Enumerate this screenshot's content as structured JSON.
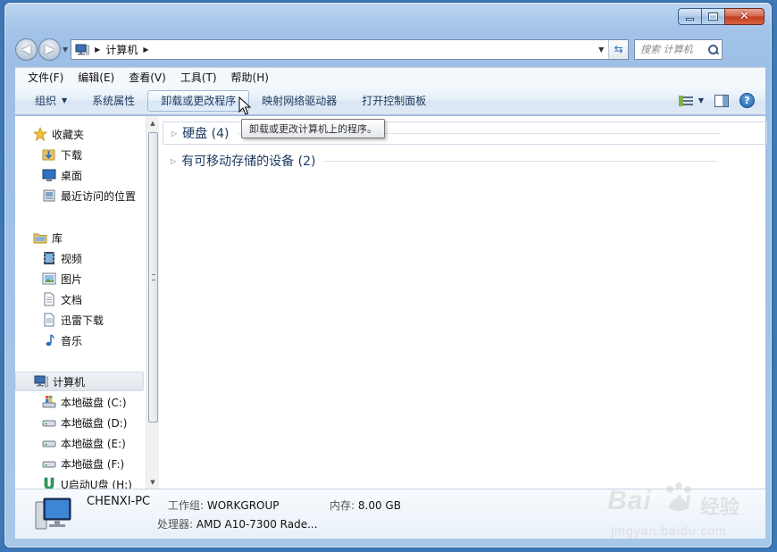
{
  "window": {
    "caption_min": "",
    "caption_max": "",
    "caption_close": "✕"
  },
  "nav": {
    "back": "◀",
    "forward": "▶",
    "address_segments": [
      "计算机"
    ],
    "search_placeholder": "搜索 计算机"
  },
  "menubar": {
    "items": [
      "文件(F)",
      "编辑(E)",
      "查看(V)",
      "工具(T)",
      "帮助(H)"
    ]
  },
  "toolbar": {
    "organize": "组织",
    "system_properties": "系统属性",
    "uninstall": "卸载或更改程序",
    "map_drive": "映射网络驱动器",
    "control_panel": "打开控制面板"
  },
  "tooltip": {
    "text": "卸载或更改计算机上的程序。"
  },
  "sidebar": {
    "favorites": {
      "label": "收藏夹",
      "items": [
        "下载",
        "桌面",
        "最近访问的位置"
      ]
    },
    "libraries": {
      "label": "库",
      "items": [
        "视频",
        "图片",
        "文档",
        "迅雷下载",
        "音乐"
      ]
    },
    "computer": {
      "label": "计算机",
      "items": [
        "本地磁盘 (C:)",
        "本地磁盘 (D:)",
        "本地磁盘 (E:)",
        "本地磁盘 (F:)",
        "U启动U盘 (H:)"
      ]
    }
  },
  "main": {
    "groups": [
      {
        "title": "硬盘 (4)"
      },
      {
        "title": "有可移动存储的设备 (2)"
      }
    ]
  },
  "details": {
    "name": "CHENXI-PC",
    "workgroup_label": "工作组:",
    "workgroup_value": "WORKGROUP",
    "memory_label": "内存:",
    "memory_value": "8.00 GB",
    "cpu_label": "处理器:",
    "cpu_value": "AMD A10-7300 Rade..."
  },
  "watermark": {
    "brand": "Bai",
    "brand2": "u",
    "cn": "经验",
    "sub": "jingyan.baidu.com"
  },
  "colors": {
    "frame": "#a3c3e8",
    "accent": "#1e3b63",
    "close": "#c13b21"
  }
}
